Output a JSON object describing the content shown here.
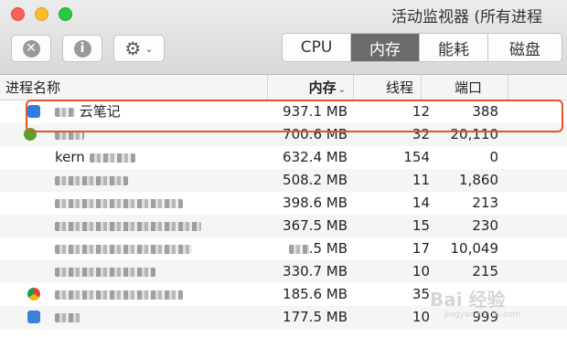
{
  "window": {
    "title": "活动监视器 (所有进程"
  },
  "toolbar": {
    "stop_label": "✕",
    "info_label": "i",
    "gear_glyph": "⚙",
    "chevron_glyph": "⌄"
  },
  "tabs": [
    {
      "label": "CPU",
      "active": false
    },
    {
      "label": "内存",
      "active": true
    },
    {
      "label": "能耗",
      "active": false
    },
    {
      "label": "磁盘",
      "active": false
    }
  ],
  "columns": {
    "name": "进程名称",
    "memory": "内存",
    "memory_sort": "⌄",
    "threads": "线程",
    "ports": "端口"
  },
  "rows": [
    {
      "name": "云笔记",
      "memory": "937.1 MB",
      "threads": "12",
      "ports": "388",
      "icon": "note-app-icon",
      "icon_color": "#2f7de1"
    },
    {
      "name": "",
      "memory": "700.6 MB",
      "threads": "32",
      "ports": "20,110",
      "icon": "app-icon",
      "icon_color": "#5aa02c"
    },
    {
      "name": "kern",
      "memory": "632.4 MB",
      "threads": "154",
      "ports": "0",
      "icon": "",
      "icon_color": ""
    },
    {
      "name": "",
      "memory": "508.2 MB",
      "threads": "11",
      "ports": "1,860",
      "icon": "",
      "icon_color": ""
    },
    {
      "name": "",
      "memory": "398.6 MB",
      "threads": "14",
      "ports": "213",
      "icon": "",
      "icon_color": ""
    },
    {
      "name": "",
      "memory": "367.5 MB",
      "threads": "15",
      "ports": "230",
      "icon": "",
      "icon_color": ""
    },
    {
      "name": "",
      "memory": ".5 MB",
      "threads": "17",
      "ports": "10,049",
      "icon": "",
      "icon_color": ""
    },
    {
      "name": "",
      "memory": "330.7 MB",
      "threads": "10",
      "ports": "215",
      "icon": "",
      "icon_color": ""
    },
    {
      "name": "",
      "memory": "185.6 MB",
      "threads": "35",
      "ports": "",
      "icon": "chrome-icon",
      "icon_color": "#db4437"
    },
    {
      "name": "",
      "memory": "177.5 MB",
      "threads": "10",
      "ports": "999",
      "icon": "app-icon",
      "icon_color": "#3b82d6"
    }
  ],
  "watermark": {
    "text": "Bai 经验",
    "sub": "jingyan.baidu.com"
  },
  "colors": {
    "highlight": "#e8532a",
    "active_tab": "#6b6b6b"
  }
}
